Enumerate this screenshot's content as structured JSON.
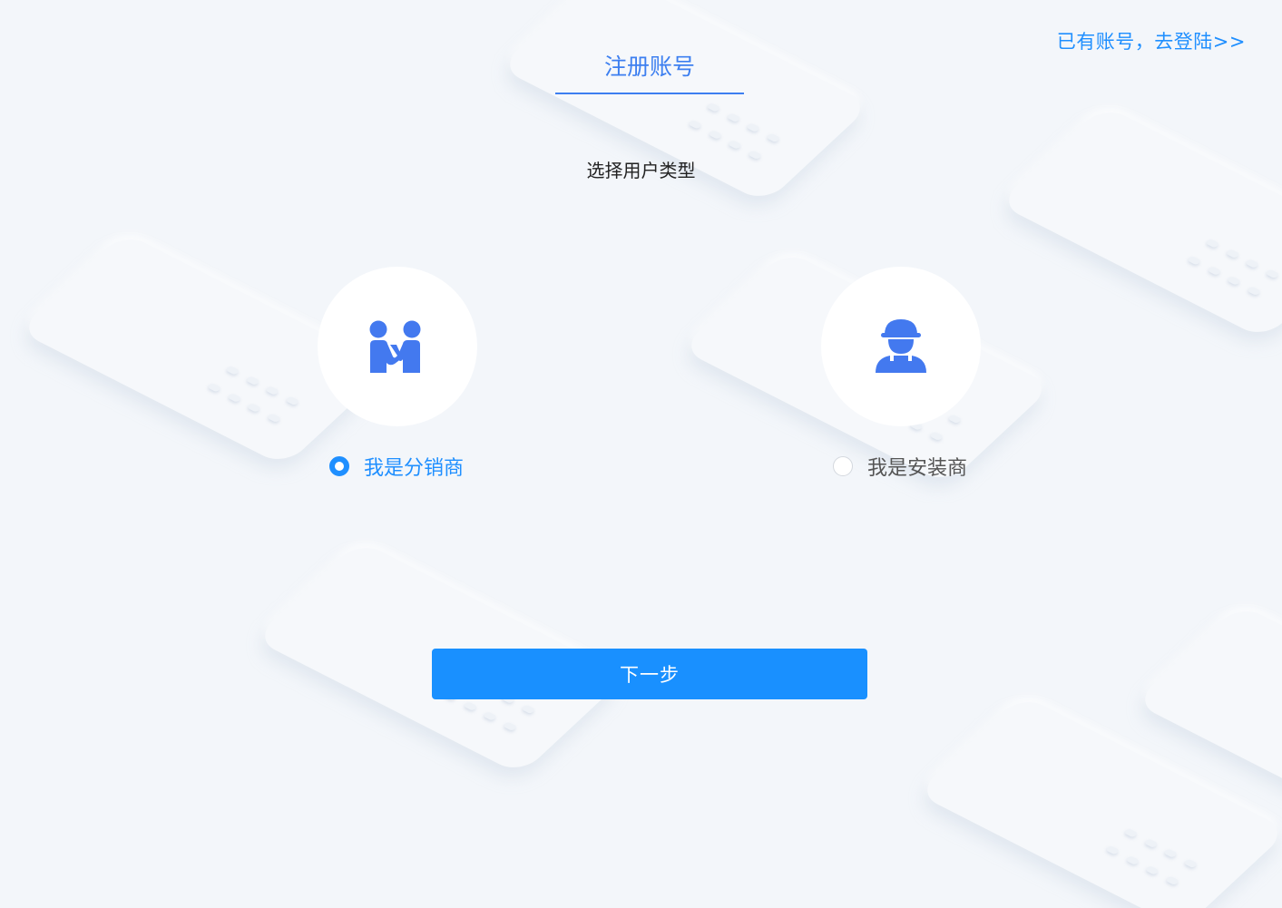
{
  "header": {
    "title": "注册账号",
    "login_link": "已有账号，去登陆>>"
  },
  "main": {
    "subtitle": "选择用户类型",
    "options": [
      {
        "label": "我是分销商",
        "icon": "handshake-people-icon",
        "selected": true
      },
      {
        "label": "我是安装商",
        "icon": "worker-icon",
        "selected": false
      }
    ],
    "next_button": "下一步"
  },
  "colors": {
    "accent": "#1990ff",
    "title": "#3d7ff0",
    "icon": "#4379ef",
    "background": "#f3f6fa"
  }
}
